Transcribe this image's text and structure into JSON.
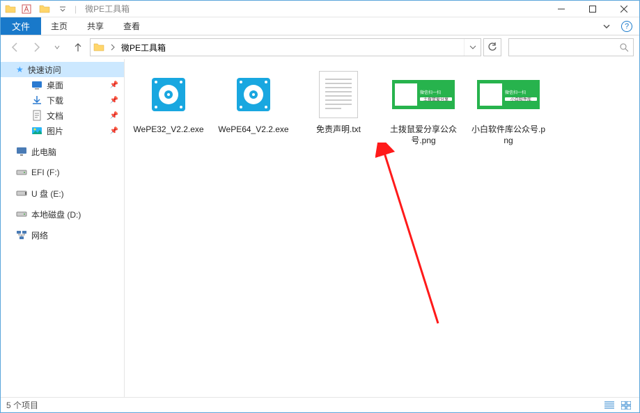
{
  "window": {
    "title": "微PE工具箱"
  },
  "ribbon": {
    "file_label": "文件",
    "tabs": [
      "主页",
      "共享",
      "查看"
    ]
  },
  "address": {
    "segment": "微PE工具箱"
  },
  "search": {
    "placeholder": ""
  },
  "sidebar": {
    "quick_access": "快速访问",
    "quick_items": [
      {
        "label": "桌面"
      },
      {
        "label": "下载"
      },
      {
        "label": "文档"
      },
      {
        "label": "图片"
      }
    ],
    "this_pc": "此电脑",
    "drives": [
      {
        "label": "EFI (F:)"
      },
      {
        "label": "U 盘 (E:)"
      },
      {
        "label": "本地磁盘 (D:)"
      }
    ],
    "network": "网络"
  },
  "files": [
    {
      "name": "WePE32_V2.2.exe",
      "type": "exe"
    },
    {
      "name": "WePE64_V2.2.exe",
      "type": "exe"
    },
    {
      "name": "免责声明.txt",
      "type": "txt"
    },
    {
      "name": "土拨鼠爱分享公众号.png",
      "type": "png"
    },
    {
      "name": "小白软件库公众号.png",
      "type": "png"
    }
  ],
  "status": {
    "count_label": "5 个项目"
  }
}
